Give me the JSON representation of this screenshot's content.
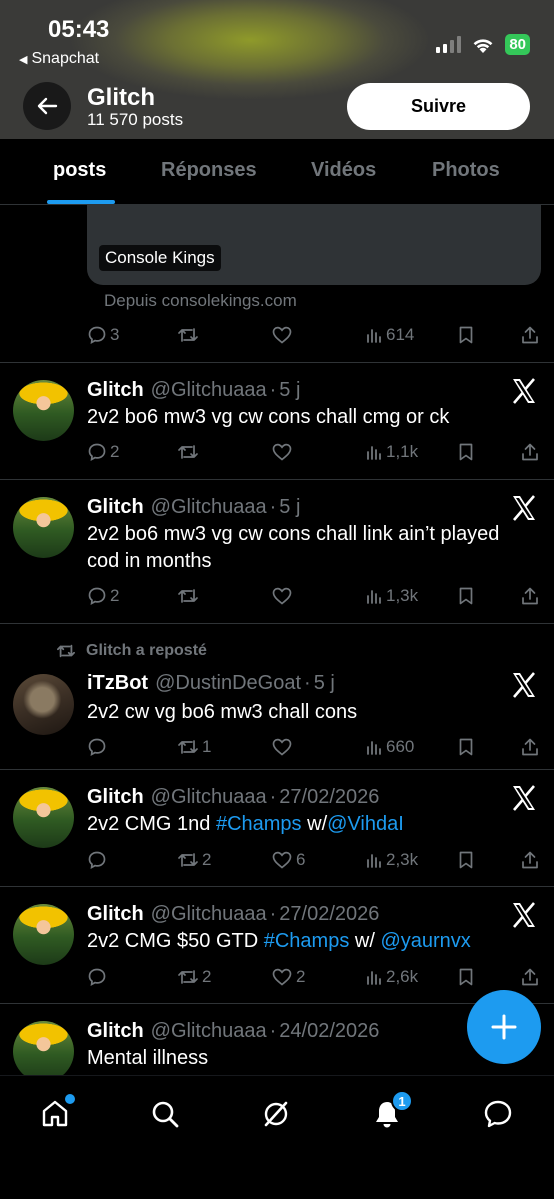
{
  "status_bar": {
    "time": "05:43",
    "back_app": "Snapchat",
    "battery": "80"
  },
  "profile": {
    "name": "Glitch",
    "posts_count": "11 570 posts",
    "follow_label": "Suivre"
  },
  "tabs": [
    {
      "label": "posts",
      "active": true
    },
    {
      "label": "Réponses",
      "active": false
    },
    {
      "label": "Vidéos",
      "active": false
    },
    {
      "label": "Photos",
      "active": false
    }
  ],
  "first_post": {
    "embed_tag": "Console Kings",
    "embed_source": "Depuis consolekings.com",
    "replies": "3",
    "reposts": "",
    "likes": "",
    "views": "614"
  },
  "posts": [
    {
      "name": "Glitch",
      "handle": "@Glitchuaaa",
      "dot": "·",
      "time": "5 j",
      "text": "2v2 bo6 mw3 vg cw cons chall cmg or ck",
      "replies": "2",
      "reposts": "",
      "likes": "",
      "views": "1,1k"
    },
    {
      "name": "Glitch",
      "handle": "@Glitchuaaa",
      "dot": "·",
      "time": "5 j",
      "text": "2v2 bo6 mw3 vg cw cons chall link ain’t played cod in months",
      "replies": "2",
      "reposts": "",
      "likes": "",
      "views": "1,3k"
    },
    {
      "reposted_by": "Glitch a reposté",
      "name": "iTzBot",
      "handle": "@DustinDeGoat",
      "dot": "·",
      "time": "5 j",
      "text": "2v2 cw vg bo6 mw3 chall cons",
      "replies": "",
      "reposts": "1",
      "likes": "",
      "views": "660"
    },
    {
      "name": "Glitch",
      "handle": "@Glitchuaaa",
      "dot": "·",
      "time": "27/02/2026",
      "text_pre": "2v2 CMG 1nd ",
      "hashtag": "#Champs",
      "text_mid": " w/",
      "mention": "@VihdaI",
      "replies": "",
      "reposts": "2",
      "likes": "6",
      "views": "2,3k"
    },
    {
      "name": "Glitch",
      "handle": "@Glitchuaaa",
      "dot": "·",
      "time": "27/02/2026",
      "text_pre": "2v2 CMG $50 GTD ",
      "hashtag": "#Champs",
      "text_mid": " w/ ",
      "mention": "@yaurnvx",
      "replies": "",
      "reposts": "2",
      "likes": "2",
      "views": "2,6k"
    },
    {
      "name": "Glitch",
      "handle": "@Glitchuaaa",
      "dot": "·",
      "time": "24/02/2026",
      "text": "Mental illness"
    }
  ],
  "bottom_nav": {
    "notifications_badge": "1"
  },
  "colors": {
    "accent": "#1d9bf0",
    "background": "#000000",
    "muted": "#71767b"
  }
}
